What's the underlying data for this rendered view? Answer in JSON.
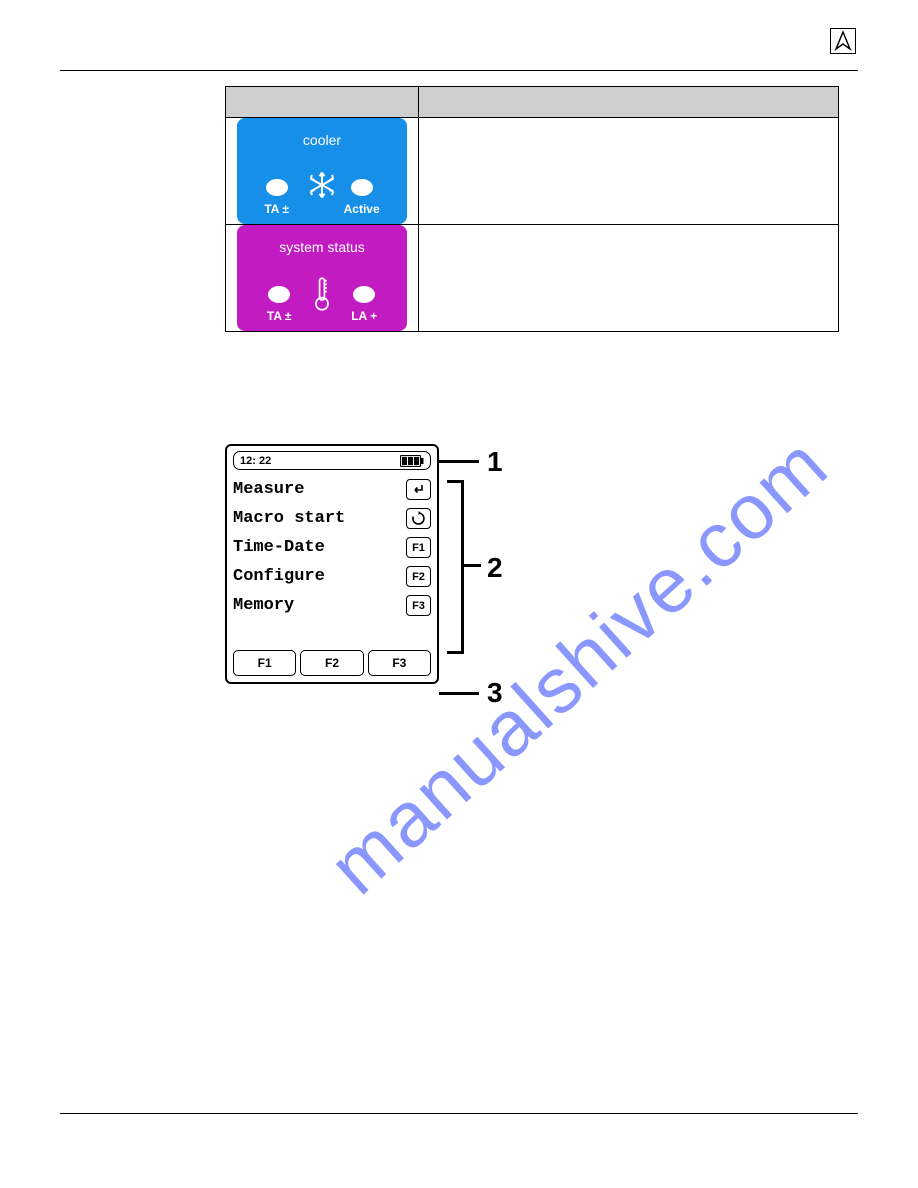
{
  "header": {
    "nav_icon": "compass-arrow-icon"
  },
  "table": {
    "rows": [
      {
        "tile": {
          "color": "blue",
          "title": "cooler",
          "left": "TA ±",
          "right": "Active",
          "center_icon": "snowflake-icon"
        }
      },
      {
        "tile": {
          "color": "magenta",
          "title": "system status",
          "left": "TA ±",
          "right": "LA +",
          "center_icon": "thermometer-icon"
        }
      }
    ]
  },
  "device": {
    "time": "12: 22",
    "menu": [
      {
        "label": "Measure",
        "key_icon": "enter-icon"
      },
      {
        "label": "Macro start",
        "key_icon": "cycle-icon"
      },
      {
        "label": "Time-Date",
        "key_label": "F1"
      },
      {
        "label": "Configure",
        "key_label": "F2"
      },
      {
        "label": "Memory",
        "key_label": "F3"
      }
    ],
    "fkeys": [
      "F1",
      "F2",
      "F3"
    ]
  },
  "callouts": {
    "n1": "1",
    "n2": "2",
    "n3": "3"
  },
  "watermark": "manualshive.com"
}
